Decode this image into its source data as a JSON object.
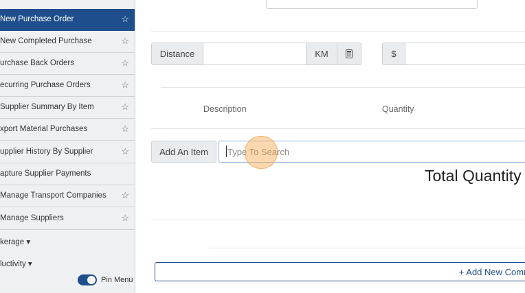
{
  "sidebar": {
    "items": [
      {
        "label": "New Purchase Order",
        "active": true,
        "starred": false
      },
      {
        "label": "New Completed Purchase",
        "active": false,
        "starred": false
      },
      {
        "label": "urchase Back Orders",
        "active": false,
        "starred": false
      },
      {
        "label": "ecurring Purchase Orders",
        "active": false,
        "starred": false
      },
      {
        "label": "Supplier Summary By Item",
        "active": false,
        "starred": false
      },
      {
        "label": "xport Material Purchases",
        "active": false,
        "starred": false
      },
      {
        "label": "upplier History By Supplier",
        "active": false,
        "starred": false
      },
      {
        "label": "apture Supplier Payments",
        "active": false,
        "starred": null
      },
      {
        "label": "Manage Transport Companies",
        "active": false,
        "starred": false
      },
      {
        "label": "Manage Suppliers",
        "active": false,
        "starred": false
      }
    ],
    "sections": [
      {
        "label": "kerage ▾"
      },
      {
        "label": "luctivity ▾"
      }
    ],
    "pin_menu_label": "Pin Menu",
    "pin_menu_on": true
  },
  "form": {
    "distance_label": "Distance",
    "distance_unit": "KM",
    "calculator_icon": "calculator-icon",
    "currency_symbol": "$",
    "columns": {
      "description": "Description",
      "quantity": "Quantity"
    },
    "add_item_label": "Add An Item",
    "search_placeholder": "Type To Search",
    "total_quantity_label": "Total Quantity",
    "add_comment_label": "+ Add New Comment"
  },
  "colors": {
    "accent": "#1f4e8c",
    "click_indicator": "#f9a84c"
  }
}
